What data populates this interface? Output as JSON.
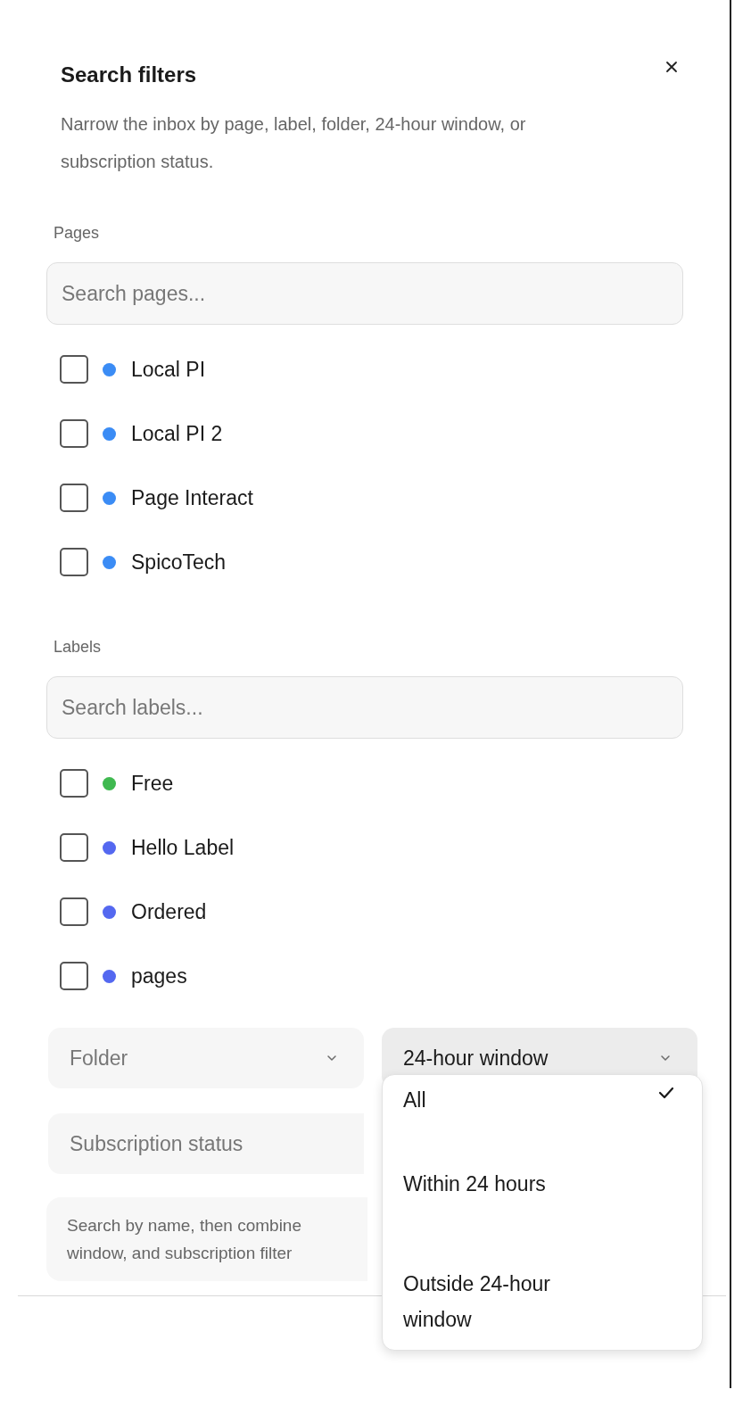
{
  "panel": {
    "title": "Search filters",
    "description": "Narrow the inbox by page, label, folder, 24-hour window, or subscription status."
  },
  "pages": {
    "heading": "Pages",
    "search": {
      "placeholder": "Search pages..."
    },
    "items": [
      {
        "label": "Local PI",
        "checked": false,
        "color": "#3b8cf5"
      },
      {
        "label": "Local PI 2",
        "checked": false,
        "color": "#3b8cf5"
      },
      {
        "label": "Page Interact",
        "checked": false,
        "color": "#3b8cf5"
      },
      {
        "label": "SpicoTech",
        "checked": false,
        "color": "#3b8cf5"
      }
    ]
  },
  "labels": {
    "heading": "Labels",
    "search": {
      "placeholder": "Search labels..."
    },
    "items": [
      {
        "label": "Free",
        "checked": false,
        "color": "#3fb950"
      },
      {
        "label": "Hello Label",
        "checked": false,
        "color": "#5468f0"
      },
      {
        "label": "Ordered",
        "checked": false,
        "color": "#5468f0"
      },
      {
        "label": "pages",
        "checked": false,
        "color": "#5468f0"
      }
    ]
  },
  "selects": {
    "folder": {
      "placeholder": "Folder"
    },
    "window": {
      "value": "24-hour window",
      "expanded": true
    },
    "subscription": {
      "placeholder": "Subscription status"
    }
  },
  "note": {
    "lines": [
      "Search by name, then combine",
      "window, and subscription filter"
    ]
  },
  "dropdown": {
    "options": [
      {
        "label": "All",
        "selected": true
      },
      {
        "label": "Within 24 hours",
        "selected": false
      },
      {
        "label": "Outside 24-hour window",
        "selected": false
      }
    ]
  }
}
